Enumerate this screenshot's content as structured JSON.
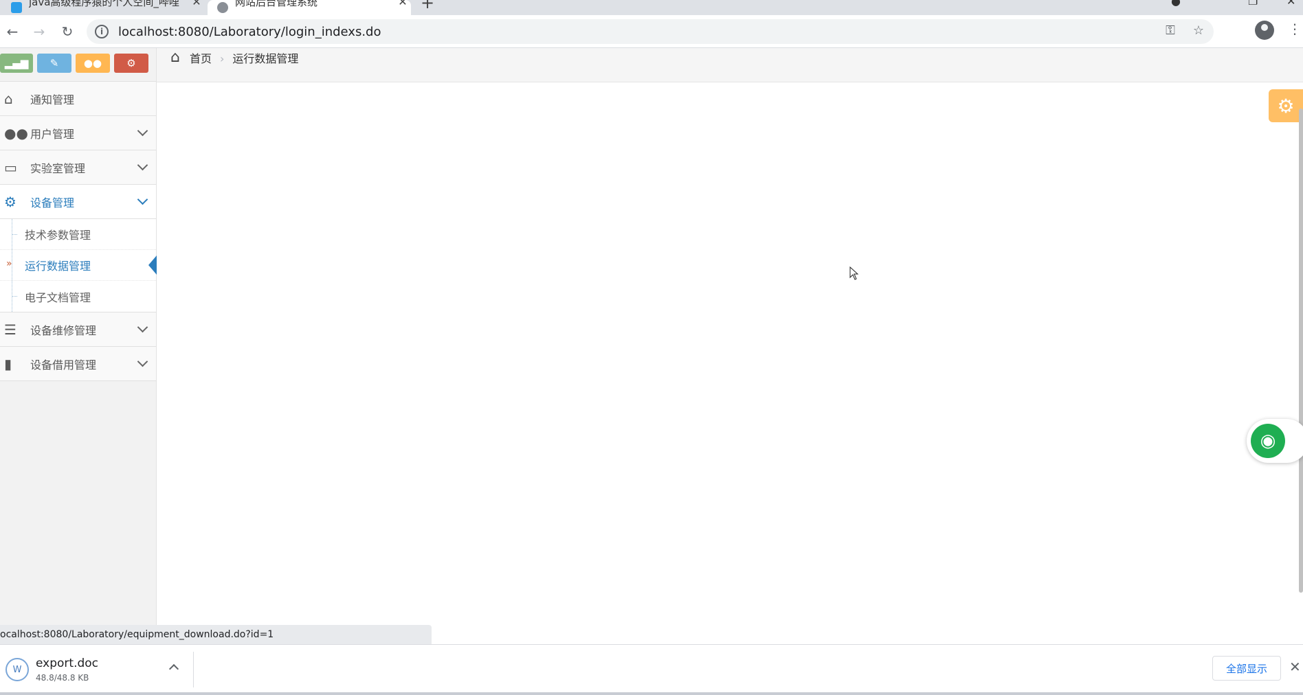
{
  "browser": {
    "tabs": [
      {
        "title": "java高级程序猿的个人空间_哔哩",
        "favicon_color": "#2b9de9"
      },
      {
        "title": "网站后台管理系统",
        "favicon_color": "#8a8f96"
      }
    ],
    "url": "localhost:8080/Laboratory/login_indexs.do",
    "status_url": "ocalhost:8080/Laboratory/equipment_download.do?id=1"
  },
  "sidebar": {
    "shortcuts": [
      {
        "icon": "signal-icon",
        "color": "#87b87f",
        "glyph": "📶"
      },
      {
        "icon": "pencil-icon",
        "color": "#6fb3e0",
        "glyph": "✎"
      },
      {
        "icon": "users-icon",
        "color": "#ffb752",
        "glyph": "👥"
      },
      {
        "icon": "cogs-icon",
        "color": "#d15b47",
        "glyph": "⚙"
      }
    ],
    "menu": [
      {
        "label": "通知管理",
        "icon": "home-icon",
        "glyph": "⌂"
      },
      {
        "label": "用户管理",
        "icon": "users-icon",
        "glyph": "👥"
      },
      {
        "label": "实验室管理",
        "icon": "desktop-icon",
        "glyph": "🖥"
      },
      {
        "label": "设备管理",
        "icon": "cogs-icon",
        "glyph": "⚙"
      },
      {
        "label": "设备维修管理",
        "icon": "list-icon",
        "glyph": "☰"
      },
      {
        "label": "设备借用管理",
        "icon": "bookmark-icon",
        "glyph": "🔖"
      }
    ],
    "submenu": [
      {
        "label": "技术参数管理"
      },
      {
        "label": "运行数据管理"
      },
      {
        "label": "电子文档管理"
      }
    ],
    "active_submenu": "运行数据管理"
  },
  "breadcrumbs": {
    "home": "首页",
    "current": "运行数据管理"
  },
  "download": {
    "filename": "export.doc",
    "size": "48.8/48.8 KB",
    "show_all": "全部显示"
  },
  "colors": {
    "accent": "#2b7dbc",
    "settings_box": "#ffb44b",
    "wifi_widget": "#1fae52"
  }
}
